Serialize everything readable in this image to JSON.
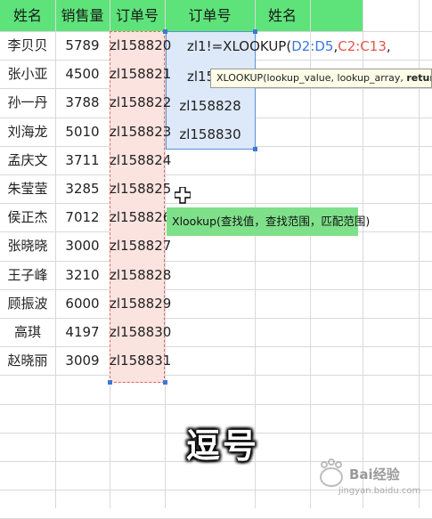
{
  "headers": {
    "name": "姓名",
    "sales": "销售量",
    "order": "订单号",
    "lookup_order": "订单号",
    "lookup_name": "姓名"
  },
  "rows": [
    {
      "name": "李贝贝",
      "sales": "5789",
      "order": "zl158820"
    },
    {
      "name": "张小亚",
      "sales": "4500",
      "order": "zl158821"
    },
    {
      "name": "孙一丹",
      "sales": "3788",
      "order": "zl158822"
    },
    {
      "name": "刘海龙",
      "sales": "5010",
      "order": "zl158823"
    },
    {
      "name": "孟庆文",
      "sales": "3711",
      "order": "zl158824"
    },
    {
      "name": "朱莹莹",
      "sales": "3285",
      "order": "zl158825"
    },
    {
      "name": "侯正杰",
      "sales": "7012",
      "order": "zl158826"
    },
    {
      "name": "张晓晓",
      "sales": "3000",
      "order": "zl158827"
    },
    {
      "name": "王子峰",
      "sales": "3210",
      "order": "zl158828"
    },
    {
      "name": "顾振波",
      "sales": "6000",
      "order": "zl158829"
    },
    {
      "name": "高琪",
      "sales": "4197",
      "order": "zl158830"
    },
    {
      "name": "赵晓丽",
      "sales": "3009",
      "order": "zl158831"
    }
  ],
  "lookup": {
    "formula_prefix": "zl1!",
    "formula_func": "=XLOOKUP(",
    "arg1": "D2:D5",
    "sep1": ",",
    "arg2": "C2:C13",
    "sep2": ",",
    "row2_partial": "zl15(",
    "orders": [
      "zl158828",
      "zl158830"
    ]
  },
  "tooltip": {
    "func": "XLOOKUP(",
    "args": "lookup_value, lookup_array, ",
    "bold_arg": "return_arr"
  },
  "note": "Xlookup(查找值，查找范围，匹配范围)",
  "caption": "逗号",
  "watermark": {
    "name": "Bai经验",
    "url": "jingyan.baidu.com"
  },
  "colors": {
    "header_green": "#5ee37a",
    "note_green": "#7fe08a",
    "selection_red": "#fbe3e0",
    "selection_blue": "#dde9f8"
  }
}
